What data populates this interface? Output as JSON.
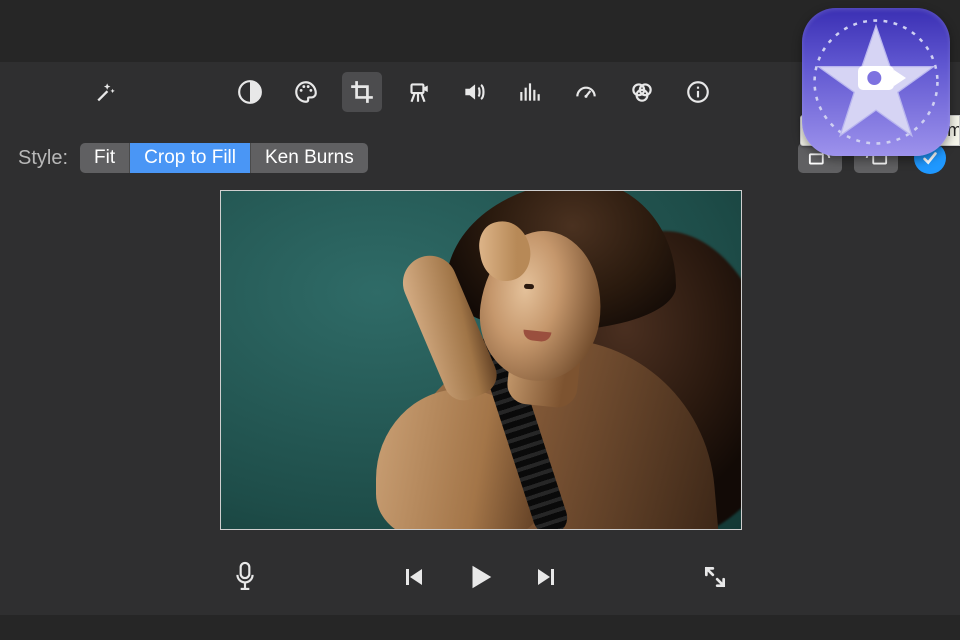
{
  "toolbar": {
    "tools": [
      {
        "name": "magic-wand",
        "active": false
      },
      {
        "name": "color-balance",
        "active": false
      },
      {
        "name": "color-correction",
        "active": false
      },
      {
        "name": "crop",
        "active": true
      },
      {
        "name": "stabilization",
        "active": false
      },
      {
        "name": "volume",
        "active": false
      },
      {
        "name": "noise-reduction",
        "active": false
      },
      {
        "name": "speed",
        "active": false
      },
      {
        "name": "clip-filter",
        "active": false
      },
      {
        "name": "info",
        "active": false
      }
    ]
  },
  "style_row": {
    "label": "Style:",
    "options": {
      "fit": "Fit",
      "crop_to_fill": "Crop to Fill",
      "ken_burns": "Ken Burns"
    },
    "selected": "crop_to_fill",
    "controls": {
      "rotate_ccw": "rotate-counterclockwise",
      "rotate_cw": "rotate-clockwise",
      "apply": "apply"
    }
  },
  "tooltip": {
    "text": "Apply crop adjustme"
  },
  "playback": {
    "mic": "voiceover",
    "prev": "previous-frame",
    "play": "play",
    "next": "next-frame",
    "fullscreen": "fullscreen"
  },
  "app_badge": {
    "name": "iMovie"
  }
}
